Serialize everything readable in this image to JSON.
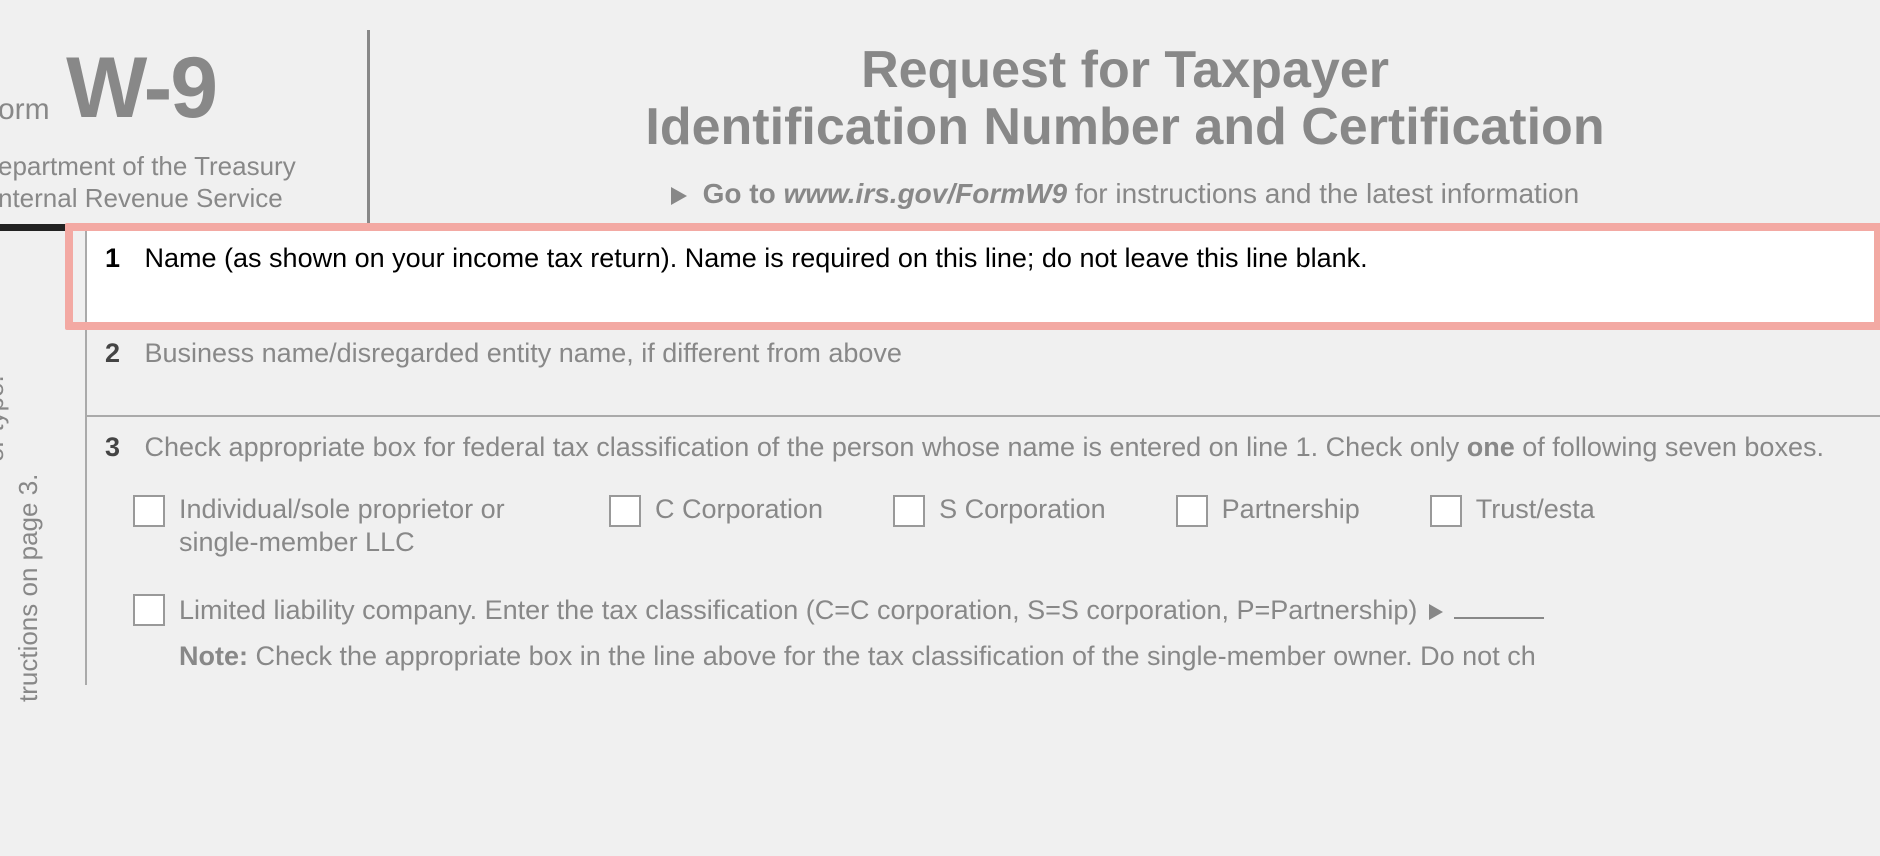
{
  "header": {
    "form_label": "orm",
    "form_code": "W-9",
    "dept_line1": "epartment of the Treasury",
    "dept_line2": "nternal Revenue Service",
    "title_line1": "Request for Taxpayer",
    "title_line2": "Identification Number and Certification",
    "goto_prefix": "Go to",
    "goto_url": "www.irs.gov/FormW9",
    "goto_suffix": "for instructions and the latest information"
  },
  "side": {
    "vertical1": "or type.",
    "vertical2": "tructions on page 3."
  },
  "rows": {
    "r1": {
      "num": "1",
      "text": "Name (as shown on your income tax return). Name is required on this line; do not leave this line blank."
    },
    "r2": {
      "num": "2",
      "text": "Business name/disregarded entity name, if different from above"
    },
    "r3": {
      "num": "3",
      "text_part1": "Check appropriate box for federal tax classification of the person whose name is entered on line 1. Check only ",
      "text_bold": "one",
      "text_part2": " of following seven boxes."
    }
  },
  "checkboxes": {
    "c1": "Individual/sole proprietor or single-member LLC",
    "c2": "C Corporation",
    "c3": "S Corporation",
    "c4": "Partnership",
    "c5": "Trust/esta"
  },
  "llc": {
    "label": "Limited liability company. Enter the tax classification (C=C corporation, S=S corporation, P=Partnership)"
  },
  "note": {
    "bold": "Note:",
    "text": " Check the appropriate box in the line above for the tax classification of the single-member owner.  Do not ch"
  }
}
